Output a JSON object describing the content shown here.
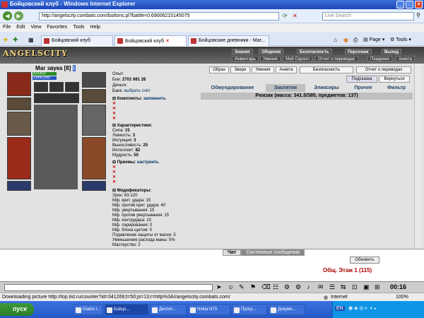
{
  "window": {
    "title": "Бойцовский клуб - Windows Internet Explorer"
  },
  "browser": {
    "url": "http://angelscity.combats.com/buttons.pl?battle=0.69006215145075",
    "search_placeholder": "Live Search",
    "menu": [
      "File",
      "Edit",
      "View",
      "Favorites",
      "Tools",
      "Help"
    ],
    "tabs": [
      "Бойцовский клуб",
      "Бойцовский клуб",
      "Бойцовские дневники - Маг..."
    ],
    "toolbar": {
      "page_label": "Page",
      "tools_label": "Tools"
    }
  },
  "game": {
    "logo": "ANGELSCITY",
    "nav_top": [
      "Знания",
      "Общение",
      "Безопасность",
      "Персонаж",
      "Выход"
    ],
    "nav_sub": [
      "Инвентарь",
      "Умения",
      "Мой Скролл",
      "Отчет о переводах",
      "Поединки",
      "Анкета"
    ],
    "character": {
      "name": "Маг звука",
      "level": "[8]",
      "hp": "832/832",
      "mana": "1349/1349"
    },
    "stats_top": {
      "exp_label": "Опыт:",
      "fights_label": "Бои:",
      "fights": "2701",
      "wins": "981",
      "draws": "28",
      "money_label": "Деньги:",
      "bank_label": "Банк:",
      "bank_action": "выбрать счёт"
    },
    "komplekty": {
      "title": "Комплекты:",
      "action": "запомнить"
    },
    "characteristics": {
      "title": "Характеристики:",
      "items": [
        {
          "label": "Сила:",
          "value": "15"
        },
        {
          "label": "Ловкость:",
          "value": "3"
        },
        {
          "label": "Интуиция:",
          "value": "3"
        },
        {
          "label": "Выносливость:",
          "value": "25"
        },
        {
          "label": "Интеллект:",
          "value": "82"
        },
        {
          "label": "Мудрость:",
          "value": "50"
        }
      ]
    },
    "priemy": {
      "title": "Приемы:",
      "action": "настроить"
    },
    "modifiers": {
      "title": "Модификаторы:",
      "items": [
        "Урон: 63-120",
        "Мф. крит. удара: 15",
        "Мф. против крит. удара: 40",
        "Мф. увертывания: 15",
        "Мф. против увертывания: 15",
        "Мф. контрудара: 10",
        "Мф. парирования: 0",
        "Мф. блока щитом: 0",
        "Подавление защиты от магии: 5",
        "Уменьшение расхода маны: 5%",
        "Мастерство: 2"
      ]
    },
    "buttons": [
      "Образ",
      "Звери",
      "Умения",
      "Анкета",
      "Безопасность",
      "Отчет о переводах"
    ],
    "buttons2": [
      "Подсказка",
      "Вернуться"
    ],
    "inv_tabs": [
      "Обмундирование",
      "Заклятия",
      "Эликсиры",
      "Прочее",
      "Фильтр"
    ],
    "rucksack": "Рюкзак (масса: 341.5/385, предметов: 137)"
  },
  "chat": {
    "tabs": [
      "Чат",
      "Системные сообщения"
    ],
    "refresh_button": "Обновить",
    "room": "Общ. Этаж 1 (115)",
    "clock": "00:16"
  },
  "status": {
    "text": "Downloading picture http://top.list.ru/counter?id=341269;t=50;js=13;r=http%3A//angelscity.combats.com/",
    "zone": "Internet",
    "zoom": "100%"
  },
  "taskbar": {
    "start": "пуск",
    "tasks": [
      "Diablo I...",
      "Бойцо...",
      "Диспет...",
      "Nokia N73",
      "Прогр...",
      "Докуме..."
    ],
    "lang": "EN"
  }
}
